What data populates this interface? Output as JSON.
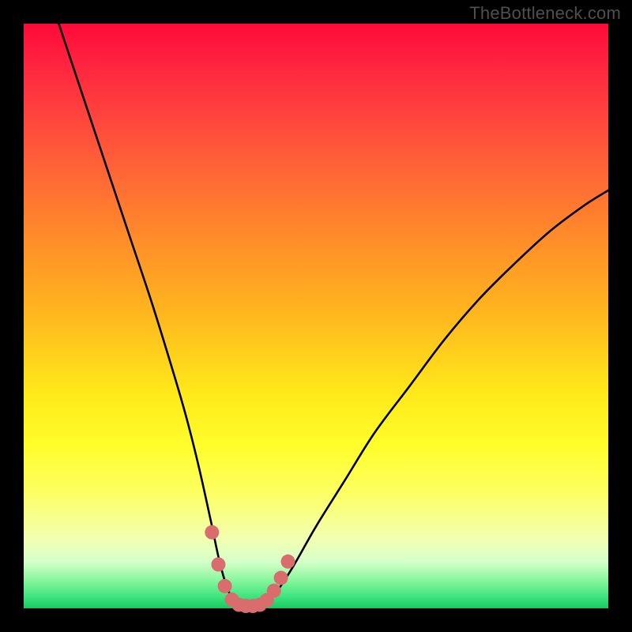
{
  "watermark": "TheBottleneck.com",
  "chart_data": {
    "type": "line",
    "title": "",
    "xlabel": "",
    "ylabel": "",
    "xlim": [
      0,
      100
    ],
    "ylim": [
      0,
      100
    ],
    "series": [
      {
        "name": "bottleneck-curve",
        "x": [
          6,
          10,
          14,
          18,
          22,
          26,
          28,
          30,
          32,
          33.5,
          35,
          36.5,
          38,
          39.5,
          41,
          43,
          46,
          50,
          55,
          60,
          66,
          72,
          78,
          84,
          90,
          96,
          100
        ],
        "values": [
          100,
          88,
          76,
          64,
          52,
          39,
          32,
          24,
          15,
          8,
          3,
          0.8,
          0.5,
          0.5,
          0.8,
          2.5,
          7,
          14,
          22,
          30,
          38,
          46,
          53,
          59,
          64.5,
          69,
          71.5
        ]
      }
    ],
    "highlights": {
      "name": "optimal-range-dots",
      "x": [
        32.2,
        33.3,
        34.4,
        35.6,
        36.8,
        38.0,
        39.2,
        40.4,
        41.6,
        42.8,
        44.0,
        45.2
      ],
      "values": [
        13.0,
        7.5,
        3.8,
        1.5,
        0.6,
        0.4,
        0.4,
        0.6,
        1.4,
        3.0,
        5.2,
        8.0
      ]
    },
    "colors": {
      "curve": "#000000",
      "dots": "#d96c6c"
    }
  }
}
